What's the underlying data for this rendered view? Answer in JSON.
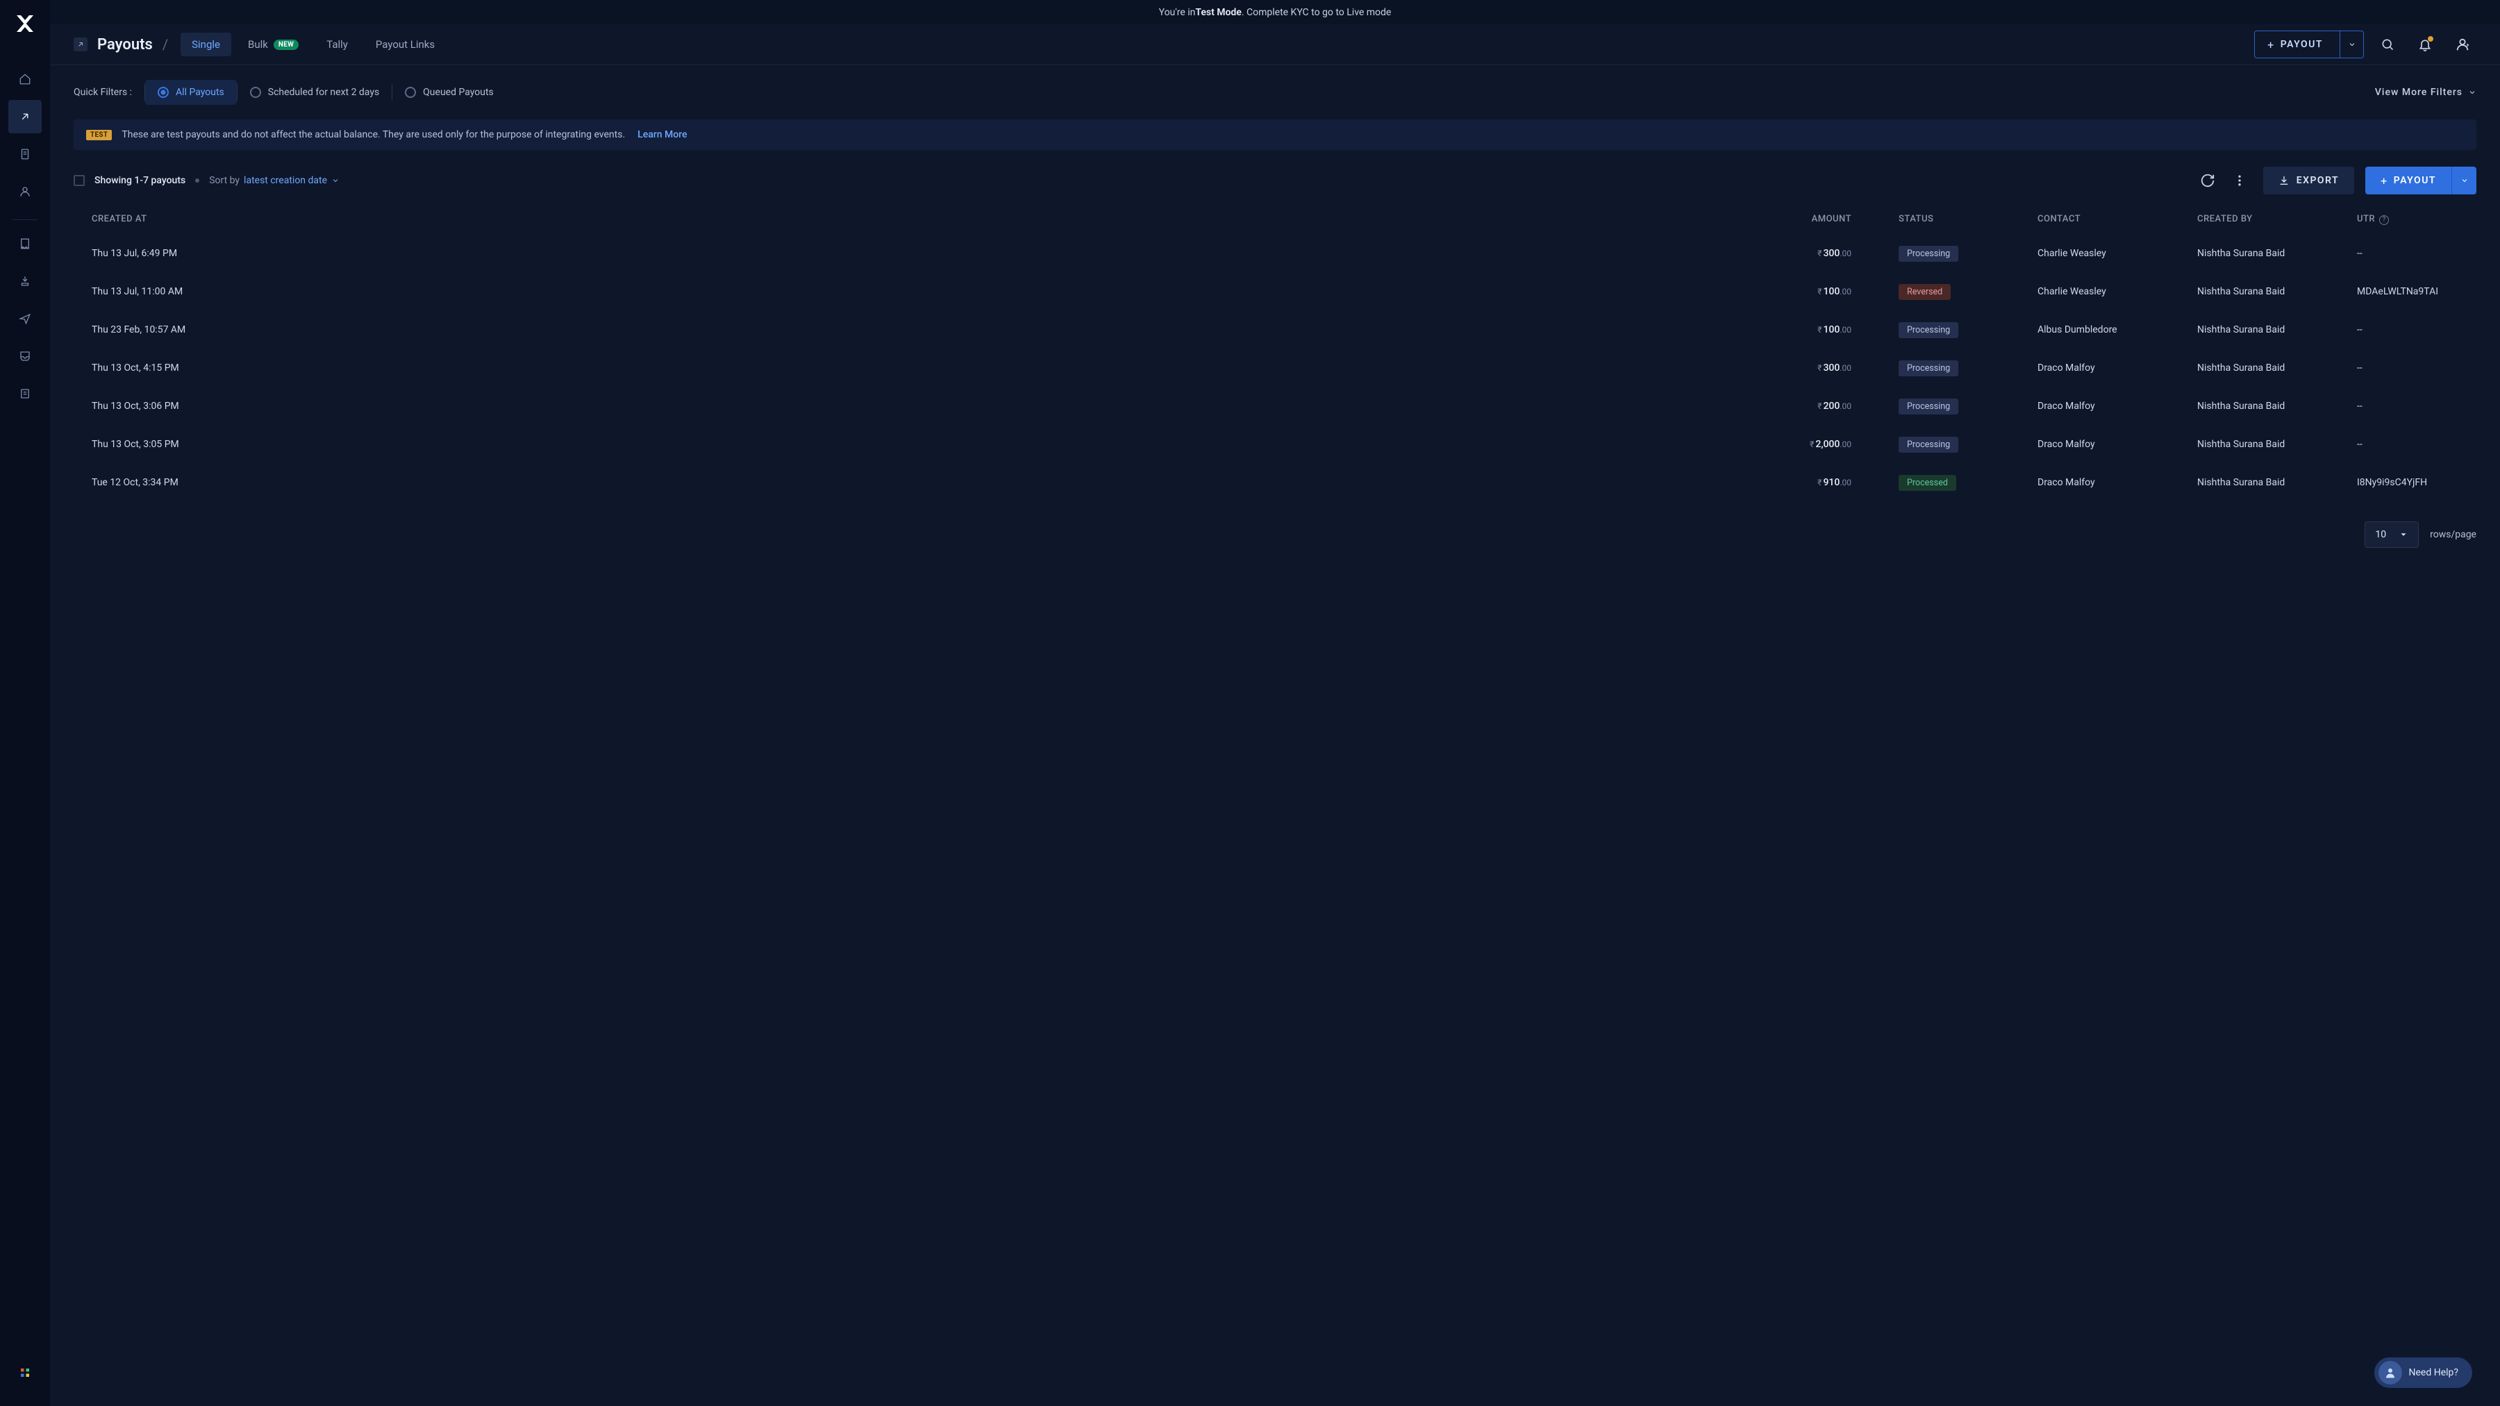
{
  "notice": {
    "prefix": "You're in ",
    "bold": "Test Mode",
    "suffix": ". Complete KYC to go to Live mode"
  },
  "header": {
    "page_title": "Payouts",
    "tabs": [
      {
        "label": "Single",
        "active": true
      },
      {
        "label": "Bulk",
        "badge": "NEW"
      },
      {
        "label": "Tally"
      },
      {
        "label": "Payout Links"
      }
    ],
    "payout_btn": "PAYOUT"
  },
  "filters": {
    "label": "Quick Filters :",
    "items": [
      {
        "label": "All Payouts",
        "checked": true
      },
      {
        "label": "Scheduled for next 2 days",
        "checked": false
      },
      {
        "label": "Queued Payouts",
        "checked": false
      }
    ],
    "view_more": "View More Filters"
  },
  "banner": {
    "tag": "TEST",
    "text": "These are test payouts and do not affect the actual balance. They are used only for the purpose of integrating events.",
    "learn_more": "Learn More"
  },
  "list": {
    "showing": "Showing 1-7 payouts",
    "sort_by_label": "Sort by",
    "sort_by_value": "latest creation date",
    "export": "EXPORT",
    "payout": "PAYOUT"
  },
  "columns": {
    "created_at": "CREATED AT",
    "amount": "AMOUNT",
    "status": "STATUS",
    "contact": "CONTACT",
    "created_by": "CREATED BY",
    "utr": "UTR"
  },
  "rows": [
    {
      "created_at": "Thu 13 Jul, 6:49 PM",
      "amount_main": "300",
      "amount_dec": ".00",
      "status": "Processing",
      "status_class": "st-processing",
      "contact": "Charlie Weasley",
      "created_by": "Nishtha Surana Baid",
      "utr": "--"
    },
    {
      "created_at": "Thu 13 Jul, 11:00 AM",
      "amount_main": "100",
      "amount_dec": ".00",
      "status": "Reversed",
      "status_class": "st-reversed",
      "contact": "Charlie Weasley",
      "created_by": "Nishtha Surana Baid",
      "utr": "MDAeLWLTNa9TAI"
    },
    {
      "created_at": "Thu 23 Feb, 10:57 AM",
      "amount_main": "100",
      "amount_dec": ".00",
      "status": "Processing",
      "status_class": "st-processing",
      "contact": "Albus Dumbledore",
      "created_by": "Nishtha Surana Baid",
      "utr": "--"
    },
    {
      "created_at": "Thu 13 Oct, 4:15 PM",
      "amount_main": "300",
      "amount_dec": ".00",
      "status": "Processing",
      "status_class": "st-processing",
      "contact": "Draco Malfoy",
      "created_by": "Nishtha Surana Baid",
      "utr": "--"
    },
    {
      "created_at": "Thu 13 Oct, 3:06 PM",
      "amount_main": "200",
      "amount_dec": ".00",
      "status": "Processing",
      "status_class": "st-processing",
      "contact": "Draco Malfoy",
      "created_by": "Nishtha Surana Baid",
      "utr": "--"
    },
    {
      "created_at": "Thu 13 Oct, 3:05 PM",
      "amount_main": "2,000",
      "amount_dec": ".00",
      "status": "Processing",
      "status_class": "st-processing",
      "contact": "Draco Malfoy",
      "created_by": "Nishtha Surana Baid",
      "utr": "--"
    },
    {
      "created_at": "Tue 12 Oct, 3:34 PM",
      "amount_main": "910",
      "amount_dec": ".00",
      "status": "Processed",
      "status_class": "st-processed",
      "contact": "Draco Malfoy",
      "created_by": "Nishtha Surana Baid",
      "utr": "I8Ny9i9sC4YjFH"
    }
  ],
  "pager": {
    "size": "10",
    "rows_label": "rows/page"
  },
  "help": {
    "label": "Need Help?"
  }
}
